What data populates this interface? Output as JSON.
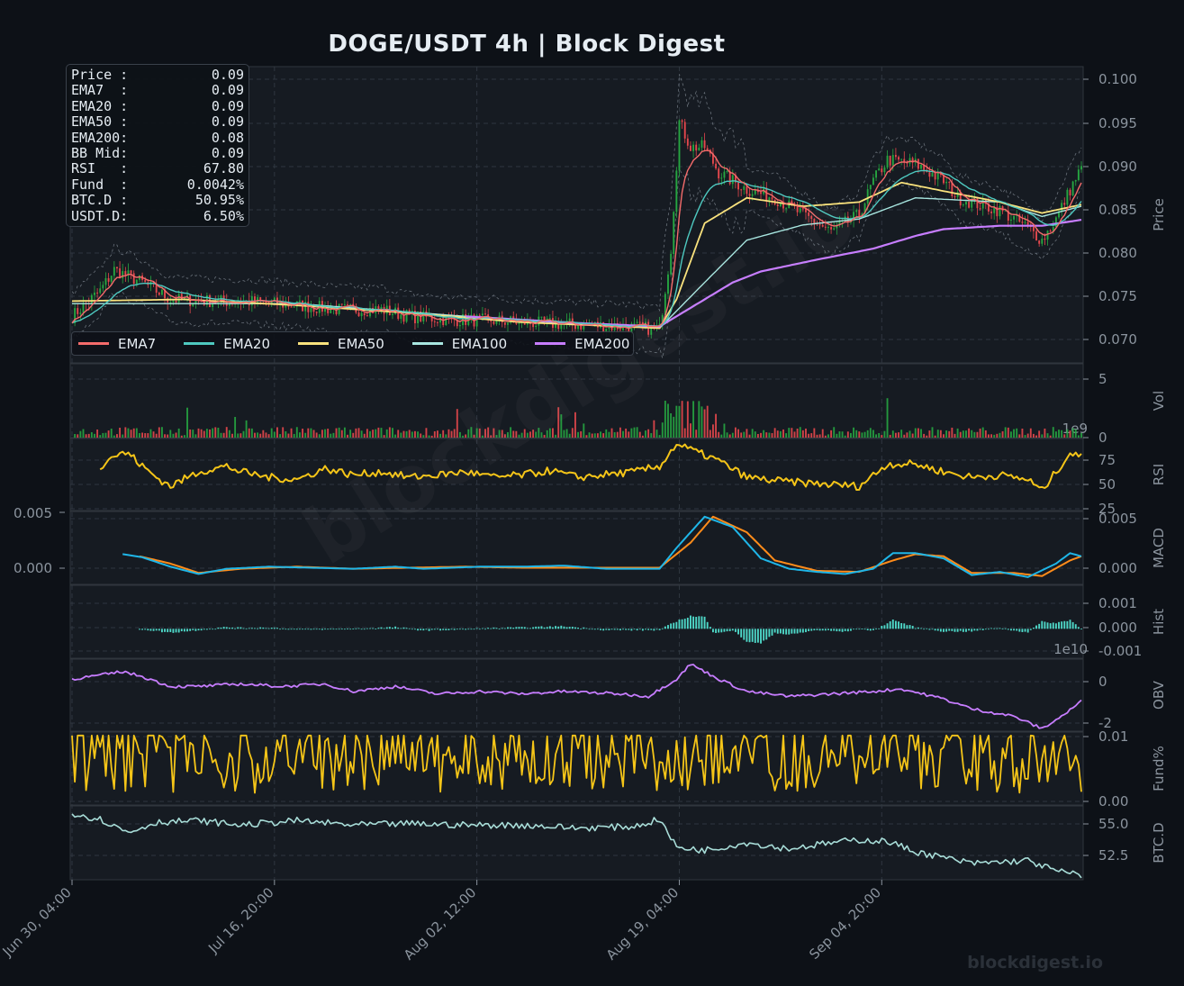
{
  "title": "DOGE/USDT  4h  |  Block Digest",
  "watermark": "blockdigest.io",
  "brand": "blockdigest.io",
  "info": [
    {
      "label": "Price :",
      "value": "0.09"
    },
    {
      "label": "EMA7  :",
      "value": "0.09"
    },
    {
      "label": "EMA20 :",
      "value": "0.09"
    },
    {
      "label": "EMA50 :",
      "value": "0.09"
    },
    {
      "label": "EMA200:",
      "value": "0.08"
    },
    {
      "label": "BB Mid:",
      "value": "0.09"
    },
    {
      "label": "RSI   :",
      "value": "67.80"
    },
    {
      "label": "Fund  :",
      "value": "0.0042%"
    },
    {
      "label": "BTC.D :",
      "value": "50.95%"
    },
    {
      "label": "USDT.D:",
      "value": "6.50%"
    }
  ],
  "colors": {
    "background": "#0d1117",
    "panel": "#161b22",
    "grid": "#2f3640",
    "up": "#26a641",
    "down": "#e5484d",
    "ema7": "#f46b6b",
    "ema20": "#4ec9c0",
    "ema50": "#f9e27d",
    "ema100": "#a8e6e0",
    "ema200": "#c77dff",
    "bb": "#8b949e",
    "rsi": "#f5c518",
    "macd": "#1fb6e8",
    "signal": "#ff8c1a",
    "hist": "#4ed8c8",
    "obv": "#c77dff",
    "funding": "#f5c518",
    "btcd": "#a8ddd8",
    "text": "#8b949e"
  },
  "chart_data": {
    "type": "line",
    "x_ticks": [
      "Jun 30, 04:00",
      "Jul 16, 20:00",
      "Aug 02, 12:00",
      "Aug 19, 04:00",
      "Sep 04, 20:00"
    ],
    "legend": [
      "EMA7",
      "EMA20",
      "EMA50",
      "EMA100",
      "EMA200"
    ],
    "legend_position": "bottom-left",
    "grid": true,
    "panels": [
      {
        "name": "Price",
        "ylim": [
          0.0665,
          0.1015
        ],
        "ticks": [
          "0.100",
          "0.095",
          "0.090",
          "0.085",
          "0.080",
          "0.075",
          "0.070"
        ],
        "series": {
          "close": [
            [
              0,
              0.072
            ],
            [
              10,
              0.075
            ],
            [
              15,
              0.0775
            ],
            [
              25,
              0.076
            ],
            [
              35,
              0.074
            ],
            [
              50,
              0.0738
            ],
            [
              65,
              0.0737
            ],
            [
              80,
              0.0733
            ],
            [
              95,
              0.0728
            ],
            [
              110,
              0.0728
            ],
            [
              120,
              0.072
            ],
            [
              135,
              0.0716
            ],
            [
              150,
              0.0715
            ],
            [
              165,
              0.0712
            ],
            [
              180,
              0.071
            ],
            [
              195,
              0.0708
            ],
            [
              209,
              0.0705
            ],
            [
              213,
              0.08
            ],
            [
              216,
              0.095
            ],
            [
              220,
              0.092
            ],
            [
              225,
              0.092
            ],
            [
              230,
              0.089
            ],
            [
              240,
              0.087
            ],
            [
              250,
              0.086
            ],
            [
              260,
              0.084
            ],
            [
              270,
              0.082
            ],
            [
              280,
              0.084
            ],
            [
              285,
              0.088
            ],
            [
              290,
              0.0905
            ],
            [
              300,
              0.09
            ],
            [
              310,
              0.088
            ],
            [
              315,
              0.086
            ],
            [
              325,
              0.085
            ],
            [
              330,
              0.0845
            ],
            [
              340,
              0.0825
            ],
            [
              345,
              0.081
            ],
            [
              350,
              0.0835
            ],
            [
              355,
              0.087
            ],
            [
              359,
              0.0895
            ]
          ],
          "ema200": [
            [
              140,
              0.072
            ],
            [
              180,
              0.0712
            ],
            [
              209,
              0.0708
            ],
            [
              220,
              0.073
            ],
            [
              235,
              0.076
            ],
            [
              245,
              0.0773
            ],
            [
              265,
              0.0787
            ],
            [
              285,
              0.08
            ],
            [
              300,
              0.0815
            ],
            [
              310,
              0.0823
            ],
            [
              330,
              0.0827
            ],
            [
              345,
              0.0827
            ],
            [
              359,
              0.0834
            ]
          ],
          "ema50": [
            [
              0,
              0.0738
            ],
            [
              40,
              0.074
            ],
            [
              80,
              0.0733
            ],
            [
              120,
              0.0724
            ],
            [
              160,
              0.0713
            ],
            [
              209,
              0.0706
            ],
            [
              215,
              0.074
            ],
            [
              225,
              0.083
            ],
            [
              240,
              0.086
            ],
            [
              260,
              0.085
            ],
            [
              280,
              0.0855
            ],
            [
              295,
              0.0878
            ],
            [
              310,
              0.0868
            ],
            [
              330,
              0.0855
            ],
            [
              345,
              0.0842
            ],
            [
              359,
              0.0852
            ]
          ],
          "ema100": [
            [
              0,
              0.0735
            ],
            [
              80,
              0.0735
            ],
            [
              160,
              0.0715
            ],
            [
              209,
              0.0706
            ],
            [
              225,
              0.076
            ],
            [
              240,
              0.081
            ],
            [
              260,
              0.0828
            ],
            [
              280,
              0.0835
            ],
            [
              300,
              0.086
            ],
            [
              330,
              0.0855
            ],
            [
              345,
              0.0838
            ],
            [
              359,
              0.085
            ]
          ]
        }
      },
      {
        "name": "Vol",
        "ylim": [
          0,
          7
        ],
        "ticks": [
          "5",
          "0"
        ],
        "offset_label": "1e9"
      },
      {
        "name": "RSI",
        "ylim": [
          20,
          85
        ],
        "ticks": [
          "75",
          "50",
          "25"
        ],
        "series": {
          "rsi": [
            [
              10,
              60
            ],
            [
              15,
              70
            ],
            [
              20,
              72
            ],
            [
              25,
              60
            ],
            [
              30,
              50
            ],
            [
              35,
              42
            ],
            [
              45,
              55
            ],
            [
              55,
              60
            ],
            [
              60,
              55
            ],
            [
              70,
              50
            ],
            [
              80,
              48
            ],
            [
              90,
              58
            ],
            [
              100,
              52
            ],
            [
              110,
              55
            ],
            [
              120,
              50
            ],
            [
              130,
              52
            ],
            [
              140,
              55
            ],
            [
              150,
              50
            ],
            [
              160,
              52
            ],
            [
              170,
              56
            ],
            [
              180,
              50
            ],
            [
              200,
              55
            ],
            [
              209,
              60
            ],
            [
              215,
              80
            ],
            [
              230,
              65
            ],
            [
              240,
              50
            ],
            [
              250,
              47
            ],
            [
              260,
              45
            ],
            [
              280,
              42
            ],
            [
              290,
              62
            ],
            [
              300,
              62
            ],
            [
              310,
              55
            ],
            [
              320,
              50
            ],
            [
              330,
              52
            ],
            [
              340,
              48
            ],
            [
              345,
              38
            ],
            [
              350,
              55
            ],
            [
              355,
              72
            ],
            [
              359,
              68
            ]
          ]
        }
      },
      {
        "name": "MACD",
        "ylim": [
          -0.0015,
          0.0055
        ],
        "ticks": [
          "0.005",
          "0.000"
        ],
        "series": {
          "macd": [
            [
              18,
              0.0014
            ],
            [
              25,
              0.0011
            ],
            [
              35,
              0.0002
            ],
            [
              45,
              -0.0005
            ],
            [
              55,
              0.0
            ],
            [
              70,
              0.0002
            ],
            [
              85,
              0.0001
            ],
            [
              100,
              0.0
            ],
            [
              115,
              0.0002
            ],
            [
              125,
              0.0
            ],
            [
              135,
              0.0001
            ],
            [
              145,
              0.0002
            ],
            [
              160,
              0.0002
            ],
            [
              175,
              0.0003
            ],
            [
              190,
              0.0
            ],
            [
              209,
              0.0
            ],
            [
              215,
              0.002
            ],
            [
              225,
              0.005
            ],
            [
              235,
              0.004
            ],
            [
              245,
              0.001
            ],
            [
              255,
              0.0
            ],
            [
              265,
              -0.0003
            ],
            [
              275,
              -0.0005
            ],
            [
              285,
              0.0
            ],
            [
              292,
              0.0015
            ],
            [
              300,
              0.0015
            ],
            [
              310,
              0.001
            ],
            [
              320,
              -0.0006
            ],
            [
              330,
              -0.0003
            ],
            [
              340,
              -0.0008
            ],
            [
              350,
              0.0005
            ],
            [
              355,
              0.0015
            ],
            [
              359,
              0.0012
            ]
          ],
          "signal": [
            [
              24,
              0.0012
            ],
            [
              35,
              0.0005
            ],
            [
              45,
              -0.0004
            ],
            [
              60,
              0.0
            ],
            [
              80,
              0.0002
            ],
            [
              100,
              0.0
            ],
            [
              120,
              0.0001
            ],
            [
              140,
              0.0002
            ],
            [
              160,
              0.0001
            ],
            [
              180,
              0.0001
            ],
            [
              209,
              0.0001
            ],
            [
              220,
              0.0025
            ],
            [
              228,
              0.005
            ],
            [
              240,
              0.0035
            ],
            [
              250,
              0.0008
            ],
            [
              265,
              -0.0002
            ],
            [
              280,
              -0.0003
            ],
            [
              292,
              0.0008
            ],
            [
              300,
              0.0014
            ],
            [
              310,
              0.0012
            ],
            [
              320,
              -0.0004
            ],
            [
              335,
              -0.0004
            ],
            [
              345,
              -0.0007
            ],
            [
              355,
              0.0008
            ],
            [
              359,
              0.0012
            ]
          ]
        }
      },
      {
        "name": "Hist",
        "ylim": [
          -0.00115,
          0.0017
        ],
        "ticks": [
          "0.001",
          "0.000",
          "-0.001"
        ],
        "offset_label": "1e10"
      },
      {
        "name": "OBV",
        "ylim": [
          -2.1,
          0.8
        ],
        "ticks": [
          "0",
          "-2"
        ],
        "series": {
          "obv": [
            [
              0,
              0.0
            ],
            [
              10,
              0.15
            ],
            [
              18,
              0.3
            ],
            [
              25,
              0.1
            ],
            [
              35,
              -0.3
            ],
            [
              45,
              -0.3
            ],
            [
              60,
              -0.2
            ],
            [
              75,
              -0.3
            ],
            [
              90,
              -0.2
            ],
            [
              100,
              -0.5
            ],
            [
              115,
              -0.3
            ],
            [
              130,
              -0.6
            ],
            [
              145,
              -0.5
            ],
            [
              160,
              -0.6
            ],
            [
              175,
              -0.5
            ],
            [
              195,
              -0.6
            ],
            [
              205,
              -0.7
            ],
            [
              215,
              0.0
            ],
            [
              220,
              0.6
            ],
            [
              230,
              0.0
            ],
            [
              240,
              -0.5
            ],
            [
              255,
              -0.7
            ],
            [
              270,
              -0.6
            ],
            [
              285,
              -0.5
            ],
            [
              295,
              -0.4
            ],
            [
              310,
              -0.8
            ],
            [
              320,
              -1.2
            ],
            [
              335,
              -1.5
            ],
            [
              345,
              -2.0
            ],
            [
              352,
              -1.5
            ],
            [
              359,
              -0.9
            ]
          ]
        }
      },
      {
        "name": "Fund%",
        "ylim": [
          -0.0003,
          0.0105
        ],
        "ticks": [
          "0.01",
          "0.00"
        ]
      },
      {
        "name": "BTC.D",
        "ylim": [
          51.3,
          56.3
        ],
        "ticks": [
          "55.0",
          "52.5"
        ],
        "series": {
          "btcd": [
            [
              0,
              55.8
            ],
            [
              10,
              55.4
            ],
            [
              20,
              54.5
            ],
            [
              30,
              55.2
            ],
            [
              45,
              55.3
            ],
            [
              60,
              55.0
            ],
            [
              80,
              55.3
            ],
            [
              100,
              55.0
            ],
            [
              120,
              55.1
            ],
            [
              140,
              55.0
            ],
            [
              160,
              55.0
            ],
            [
              180,
              54.8
            ],
            [
              200,
              54.9
            ],
            [
              209,
              55.4
            ],
            [
              215,
              53.5
            ],
            [
              225,
              53.3
            ],
            [
              240,
              53.8
            ],
            [
              255,
              53.4
            ],
            [
              270,
              53.8
            ],
            [
              280,
              54.0
            ],
            [
              290,
              53.9
            ],
            [
              300,
              53.2
            ],
            [
              310,
              52.8
            ],
            [
              320,
              52.4
            ],
            [
              330,
              52.5
            ],
            [
              340,
              52.6
            ],
            [
              350,
              51.9
            ],
            [
              359,
              51.6
            ]
          ]
        }
      }
    ]
  }
}
